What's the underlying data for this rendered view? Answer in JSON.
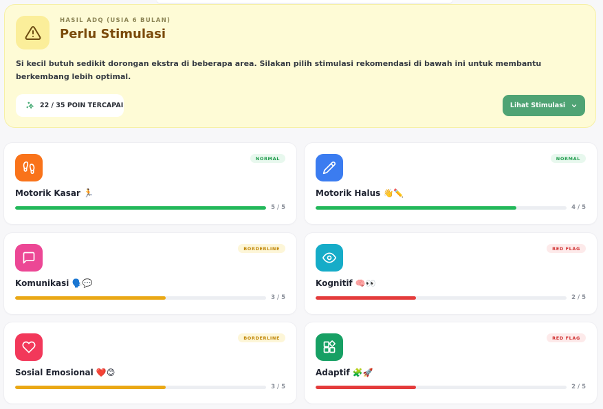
{
  "summary": {
    "eyebrow": "HASIL ADQ (USIA 6 BULAN)",
    "title": "Perlu Stimulasi",
    "description": "Si kecil butuh sedikit dorongan ekstra di beberapa area. Silakan pilih stimulasi rekomendasi di bawah ini untuk membantu berkembang lebih optimal.",
    "points_label": "22 / 35 POIN TERCAPAI",
    "points_value": 22,
    "points_max": 35,
    "cta_label": "Lihat Stimulasi",
    "icon": "warning-icon",
    "colors": {
      "background": "#fefbd6",
      "title": "#7a4a0a",
      "cta": "#4fa374"
    }
  },
  "cards": [
    {
      "key": "motorik-kasar",
      "title": "Motorik Kasar 🏃",
      "badge": "NORMAL",
      "status": "normal",
      "score_label": "5 / 5",
      "score": 5,
      "max": 5,
      "icon": "footprints-icon",
      "icon_color": "#f9731a"
    },
    {
      "key": "motorik-halus",
      "title": "Motorik Halus 👋✏️",
      "badge": "NORMAL",
      "status": "normal",
      "score_label": "4 / 5",
      "score": 4,
      "max": 5,
      "icon": "pencil-icon",
      "icon_color": "#3b7cf0"
    },
    {
      "key": "komunikasi",
      "title": "Komunikasi 🗣️💬",
      "badge": "BORDERLINE",
      "status": "borderline",
      "score_label": "3 / 5",
      "score": 3,
      "max": 5,
      "icon": "chat-bubble-icon",
      "icon_color": "#ec4795"
    },
    {
      "key": "kognitif",
      "title": "Kognitif 🧠👀",
      "badge": "RED FLAG",
      "status": "redflag",
      "score_label": "2 / 5",
      "score": 2,
      "max": 5,
      "icon": "eye-icon",
      "icon_color": "#16acc8"
    },
    {
      "key": "sosial-emosional",
      "title": "Sosial Emosional ❤️😊",
      "badge": "BORDERLINE",
      "status": "borderline",
      "score_label": "3 / 5",
      "score": 3,
      "max": 5,
      "icon": "heart-icon",
      "icon_color": "#f2385a"
    },
    {
      "key": "adaptif",
      "title": "Adaptif 🧩🚀",
      "badge": "RED FLAG",
      "status": "redflag",
      "score_label": "2 / 5",
      "score": 2,
      "max": 5,
      "icon": "puzzle-blocks-icon",
      "icon_color": "#17a064"
    }
  ],
  "status_colors": {
    "normal": {
      "bar": "#22b85a",
      "badge_bg": "#e8f8ee",
      "badge_text": "#1c9a4a"
    },
    "borderline": {
      "bar": "#eaa815",
      "badge_bg": "#fdf6d8",
      "badge_text": "#c18708"
    },
    "redflag": {
      "bar": "#e43b3b",
      "badge_bg": "#fdeaea",
      "badge_text": "#d03030"
    }
  }
}
